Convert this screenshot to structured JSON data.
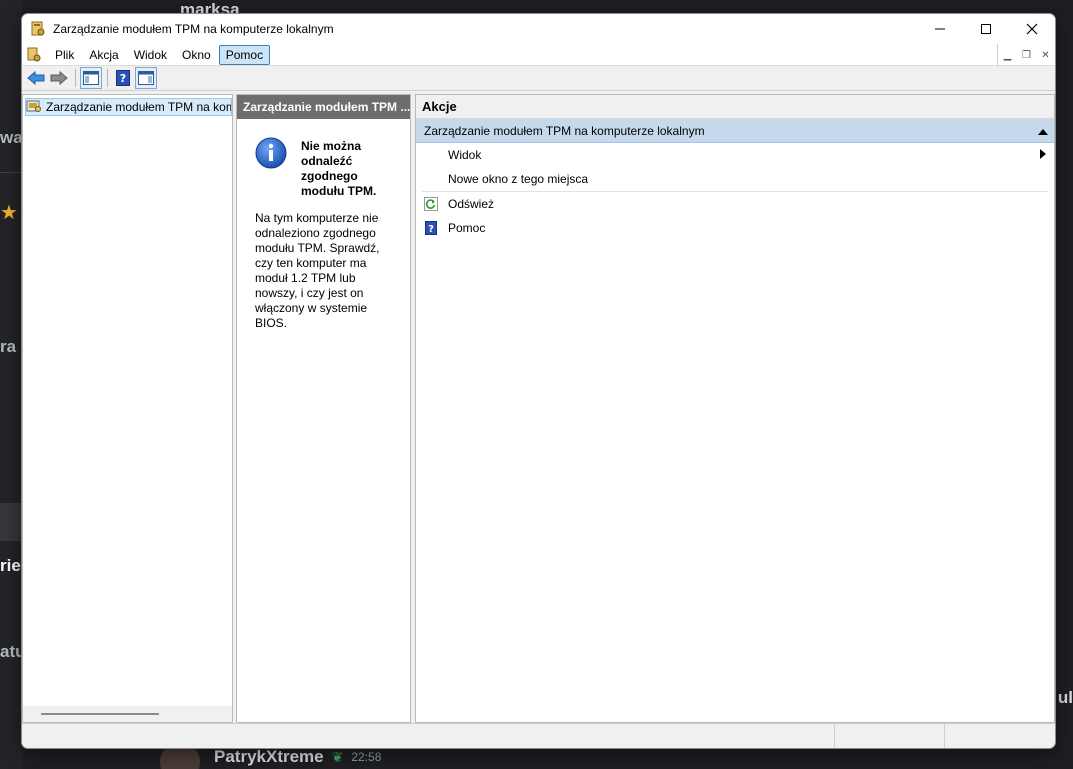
{
  "background": {
    "top_user": "marksa",
    "bottom_user": "PatrykXtreme",
    "bottom_time": "22:58",
    "left_fragments": [
      "wa",
      "ra",
      "rie",
      "atu"
    ],
    "right_fragment": "ul"
  },
  "window": {
    "title": "Zarządzanie modułem TPM na komputerze lokalnym",
    "controls": {
      "minimize": "—",
      "maximize": "☐",
      "close": "✕"
    }
  },
  "menu": {
    "items": [
      {
        "label": "Plik"
      },
      {
        "label": "Akcja"
      },
      {
        "label": "Widok"
      },
      {
        "label": "Okno"
      },
      {
        "label": "Pomoc",
        "active": true
      }
    ]
  },
  "tree": {
    "root_label": "Zarządzanie modułem TPM na komputerze lokalnym"
  },
  "middle": {
    "header": "Zarządzanie modułem TPM ...",
    "heading": "Nie można odnaleźć zgodnego modułu TPM.",
    "body": "Na tym komputerze nie odnaleziono zgodnego modułu TPM. Sprawdź, czy ten komputer ma moduł 1.2 TPM lub nowszy, i czy jest on włączony w systemie BIOS."
  },
  "actions": {
    "header": "Akcje",
    "section": "Zarządzanie modułem TPM na komputerze lokalnym",
    "items": [
      {
        "label": "Widok",
        "has_submenu": true
      },
      {
        "label": "Nowe okno z tego miejsca"
      },
      {
        "label": "Odśwież",
        "icon": "refresh-icon"
      },
      {
        "label": "Pomoc",
        "icon": "help-icon"
      }
    ]
  },
  "colors": {
    "accent_selected": "#cce4f7",
    "section_header": "#c6d9ec",
    "middle_header": "#6d6d6d"
  }
}
